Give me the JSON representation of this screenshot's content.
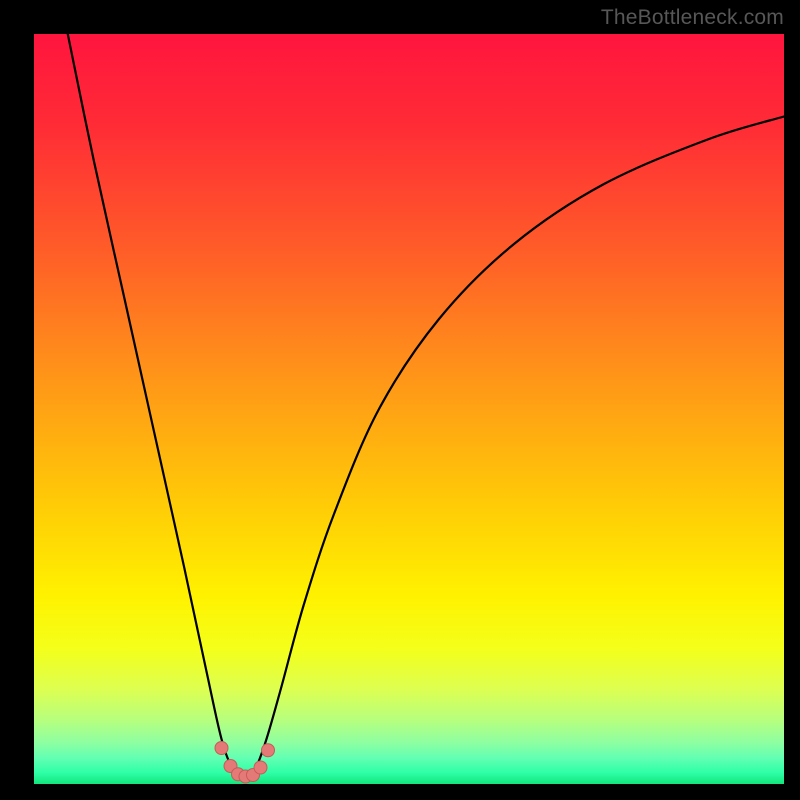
{
  "watermark": "TheBottleneck.com",
  "colors": {
    "frame": "#000000",
    "gradient_stops": [
      {
        "offset": 0.0,
        "color": "#ff153e"
      },
      {
        "offset": 0.12,
        "color": "#ff2b36"
      },
      {
        "offset": 0.28,
        "color": "#ff5a29"
      },
      {
        "offset": 0.45,
        "color": "#ff9319"
      },
      {
        "offset": 0.62,
        "color": "#ffc907"
      },
      {
        "offset": 0.75,
        "color": "#fff200"
      },
      {
        "offset": 0.82,
        "color": "#f4ff1a"
      },
      {
        "offset": 0.875,
        "color": "#dcff52"
      },
      {
        "offset": 0.915,
        "color": "#b6ff7e"
      },
      {
        "offset": 0.945,
        "color": "#8dffa1"
      },
      {
        "offset": 0.965,
        "color": "#63ffb2"
      },
      {
        "offset": 0.985,
        "color": "#2effa7"
      },
      {
        "offset": 1.0,
        "color": "#12e57c"
      }
    ],
    "curve": "#000000",
    "markers_fill": "#e47a77",
    "markers_stroke": "#c95a58"
  },
  "chart_data": {
    "type": "line",
    "title": "",
    "xlabel": "",
    "ylabel": "",
    "xlim": [
      0,
      100
    ],
    "ylim": [
      0,
      100
    ],
    "grid": false,
    "legend": false,
    "note": "Axis values estimated from pixel positions; chart has no visible tick labels. y interpreted as bottleneck % (0 at bottom, 100 at top). Curve minimum near x≈28.",
    "series": [
      {
        "name": "bottleneck-curve",
        "x": [
          4.5,
          8,
          12,
          16,
          20,
          23,
          25,
          26.5,
          28,
          29.5,
          31,
          33,
          36,
          40,
          46,
          54,
          64,
          76,
          90,
          100
        ],
        "y": [
          100,
          83,
          65,
          47,
          29,
          15,
          6,
          2,
          0.5,
          2,
          6,
          13,
          24,
          36,
          50,
          62,
          72,
          80,
          86,
          89
        ]
      }
    ],
    "markers": {
      "name": "highlight-markers",
      "x": [
        25.0,
        26.2,
        27.2,
        28.2,
        29.2,
        30.2,
        31.2
      ],
      "y": [
        4.8,
        2.4,
        1.3,
        1.0,
        1.2,
        2.2,
        4.5
      ]
    }
  }
}
